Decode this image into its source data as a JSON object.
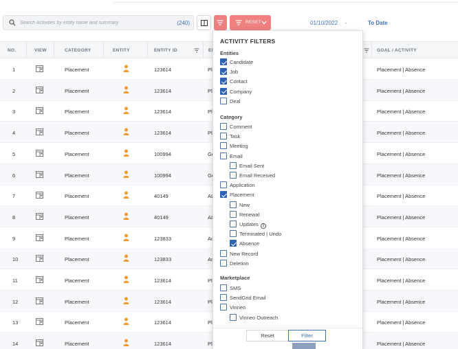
{
  "search": {
    "placeholder": "Search Activities by entity name and summary",
    "count": "(240)"
  },
  "toolbar": {
    "reset_label": "RESET",
    "date_from": "01/10/2022",
    "date_sep": "-",
    "date_to": "To Date"
  },
  "columns": [
    "NO.",
    "VIEW",
    "CATEGORY",
    "ENTITY",
    "ENTITY ID",
    "EN",
    "GOAL / ACTIVITY"
  ],
  "rows": [
    {
      "no": "1",
      "category": "Placement",
      "entity_id": "123614",
      "name": "Pl",
      "goal": "Placement | Absence"
    },
    {
      "no": "2",
      "category": "Placement",
      "entity_id": "123614",
      "name": "Pl",
      "goal": "Placement | Absence"
    },
    {
      "no": "3",
      "category": "Placement",
      "entity_id": "123614",
      "name": "Pl",
      "goal": "Placement | Absence"
    },
    {
      "no": "4",
      "category": "Placement",
      "entity_id": "123614",
      "name": "Pl",
      "goal": "Placement | Absence"
    },
    {
      "no": "5",
      "category": "Placement",
      "entity_id": "100994",
      "name": "Ge",
      "goal": "Placement | Absence"
    },
    {
      "no": "6",
      "category": "Placement",
      "entity_id": "100994",
      "name": "Ge",
      "goal": "Placement | Absence"
    },
    {
      "no": "7",
      "category": "Placement",
      "entity_id": "40149",
      "name": "AL",
      "goal": "Placement | Absence"
    },
    {
      "no": "8",
      "category": "Placement",
      "entity_id": "40149",
      "name": "AL",
      "goal": "Placement | Absence"
    },
    {
      "no": "9",
      "category": "Placement",
      "entity_id": "123833",
      "name": "An",
      "goal": "Placement | Absence"
    },
    {
      "no": "10",
      "category": "Placement",
      "entity_id": "123833",
      "name": "An",
      "goal": "Placement | Absence"
    },
    {
      "no": "11",
      "category": "Placement",
      "entity_id": "123614",
      "name": "Pl",
      "goal": "Placement | Absence"
    },
    {
      "no": "12",
      "category": "Placement",
      "entity_id": "123614",
      "name": "Pl",
      "goal": "Placement | Absence"
    },
    {
      "no": "13",
      "category": "Placement",
      "entity_id": "123614",
      "name": "Pl",
      "goal": "Placement | Absence"
    },
    {
      "no": "14",
      "category": "Placement",
      "entity_id": "123614",
      "name": "Pl",
      "goal": "Placement | Absence"
    }
  ],
  "filters": {
    "title": "ACTIVITY FILTERS",
    "entities_label": "Entities",
    "entities": [
      {
        "label": "Candidate",
        "checked": true
      },
      {
        "label": "Job",
        "checked": true
      },
      {
        "label": "Contact",
        "checked": true
      },
      {
        "label": "Company",
        "checked": true
      },
      {
        "label": "Deal",
        "checked": false
      }
    ],
    "category_label": "Category",
    "category": [
      {
        "label": "Comment",
        "checked": false,
        "indent": 0
      },
      {
        "label": "Task",
        "checked": false,
        "indent": 0
      },
      {
        "label": "Meeting",
        "checked": false,
        "indent": 0
      },
      {
        "label": "Email",
        "checked": false,
        "indent": 0
      },
      {
        "label": "Email Sent",
        "checked": false,
        "indent": 1
      },
      {
        "label": "Email Received",
        "checked": false,
        "indent": 1
      },
      {
        "label": "Application",
        "checked": false,
        "indent": 0
      },
      {
        "label": "Placement",
        "checked": true,
        "indent": 0
      },
      {
        "label": "New",
        "checked": false,
        "indent": 1
      },
      {
        "label": "Renewal",
        "checked": false,
        "indent": 1
      },
      {
        "label": "Updates",
        "checked": false,
        "indent": 1,
        "info": true
      },
      {
        "label": "Terminated | Undo",
        "checked": false,
        "indent": 1
      },
      {
        "label": "Absence",
        "checked": true,
        "indent": 1
      },
      {
        "label": "New Record",
        "checked": false,
        "indent": 0
      },
      {
        "label": "Deletion",
        "checked": false,
        "indent": 0
      }
    ],
    "marketplace_label": "Marketplace",
    "marketplace": [
      {
        "label": "SMS",
        "checked": false,
        "indent": 0
      },
      {
        "label": "SendGrid Email",
        "checked": false,
        "indent": 0
      },
      {
        "label": "Vinneo",
        "checked": false,
        "indent": 0
      },
      {
        "label": "Vinneo Outreach",
        "checked": false,
        "indent": 1
      }
    ],
    "reset_label": "Reset",
    "filter_label": "Filter"
  },
  "colors": {
    "accent": "#ef8080",
    "link": "#3b6fb6",
    "checkbox": "#2f62b0",
    "person_icon": "#f29a2e"
  },
  "icons": {
    "search": "search-icon",
    "columns": "columns-icon",
    "filter": "filter-icon",
    "chevron": "chevron-down-icon",
    "view": "view-record-icon",
    "entity": "person-icon",
    "info": "info-icon"
  }
}
